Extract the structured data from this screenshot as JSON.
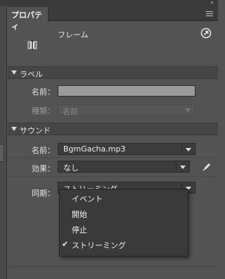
{
  "window": {
    "collapse_glyph": "»"
  },
  "tab": {
    "label": "プロパティ"
  },
  "instance": {
    "type_label": "フレーム",
    "icon": "frame-icon",
    "help_icon": "goto-icon"
  },
  "label_section": {
    "title": "ラベル",
    "name_label": "名前：",
    "name_value": "",
    "type_label": "種類：",
    "type_value": "名前"
  },
  "sound_section": {
    "title": "サウンド",
    "name_label": "名前：",
    "name_value": "BgmGacha.mp3",
    "effect_label": "効果：",
    "effect_value": "なし",
    "sync_label": "同期：",
    "sync_value": "ストリーミング",
    "edit_icon": "pencil-icon"
  },
  "sync_menu": {
    "items": [
      {
        "label": "イベント",
        "checked": false
      },
      {
        "label": "開始",
        "checked": false
      },
      {
        "label": "停止",
        "checked": false
      },
      {
        "label": "ストリーミング",
        "checked": true
      }
    ],
    "check_glyph": "✔"
  },
  "colors": {
    "panel_bg": "#535353",
    "tab_bar_bg": "#3b3b3b",
    "dropdown_bg": "#3c3c3c",
    "menu_bg": "#3a3a3a",
    "input_bg": "#9b9b9b"
  }
}
